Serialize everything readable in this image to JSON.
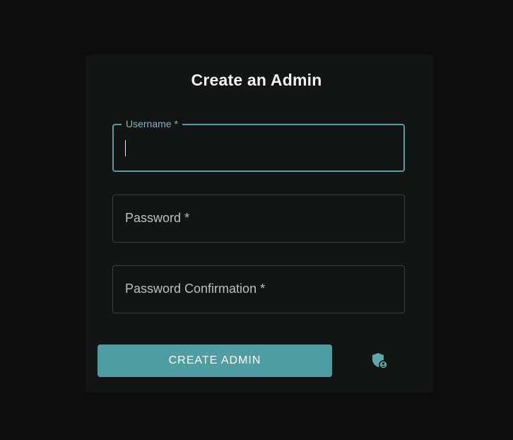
{
  "form": {
    "title": "Create an Admin",
    "username_label": "Username *",
    "username_value": "",
    "password_label": "Password *",
    "password_confirmation_label": "Password Confirmation *",
    "submit_label": "CREATE ADMIN"
  },
  "icons": {
    "admin": "shield-user-icon"
  },
  "colors": {
    "accent": "#4f9da2",
    "focus_border": "#5a9c9d",
    "background": "#0d0d0d",
    "card": "#131414"
  }
}
